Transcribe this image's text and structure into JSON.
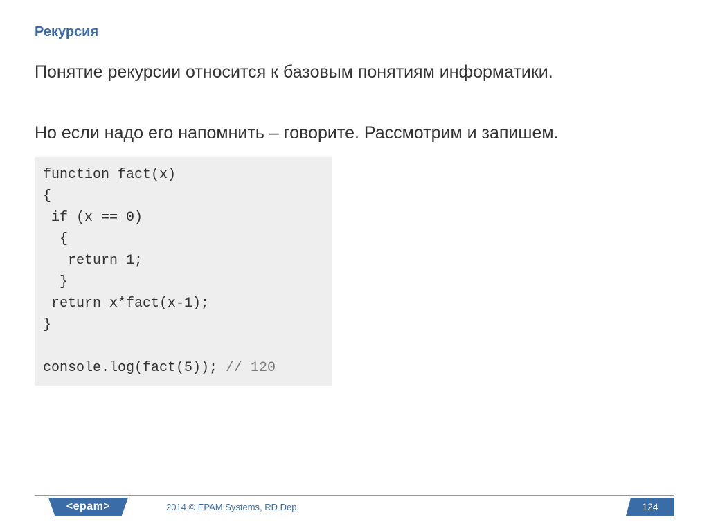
{
  "title": "Рекурсия",
  "paragraphs": {
    "p1": "Понятие рекурсии относится к базовым понятиям информатики.",
    "p2": "Но если надо его напомнить – говорите. Рассмотрим и запишем."
  },
  "code": {
    "line1": "function fact(x)",
    "line2": "{",
    "line3": " if (x == 0)",
    "line4": "  {",
    "line5": "   return 1;",
    "line6": "  }",
    "line7": " return x*fact(x-1);",
    "line8": "}",
    "line9": "",
    "line10a": "console.log(fact(5)); ",
    "line10b": "// 120"
  },
  "footer": {
    "logo": "<epam>",
    "copyright": "2014 © EPAM Systems, RD Dep.",
    "page": "124"
  }
}
